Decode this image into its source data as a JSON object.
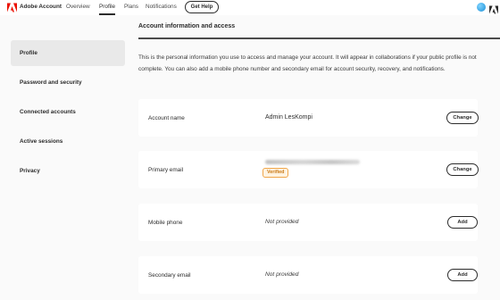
{
  "header": {
    "brand": "Adobe Account",
    "nav": [
      "Overview",
      "Profile",
      "Plans",
      "Notifications"
    ],
    "active_nav": "Profile",
    "help_button": "Get Help",
    "accent": "#eb1000"
  },
  "sidebar": {
    "items": [
      {
        "label": "Profile",
        "active": true
      },
      {
        "label": "Password and security"
      },
      {
        "label": "Connected accounts"
      },
      {
        "label": "Active sessions"
      },
      {
        "label": "Privacy"
      }
    ]
  },
  "main": {
    "section_title": "Account information and access",
    "description": "This is the personal information you use to access and manage your account. It will appear in collaborations if your public profile is not complete. You can also add a mobile phone number and secondary email for account security, recovery, and notifications.",
    "rows": [
      {
        "label": "Account name",
        "value": "Admin LesKompi",
        "action": "Change"
      },
      {
        "label": "Primary email",
        "badge": "Verified",
        "action": "Change"
      },
      {
        "label": "Mobile phone",
        "value": "Not provided",
        "action": "Add"
      },
      {
        "label": "Secondary email",
        "value": "Not provided",
        "action": "Add"
      }
    ]
  }
}
